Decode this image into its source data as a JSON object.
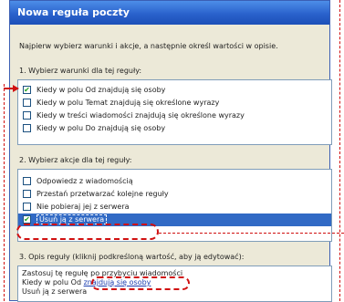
{
  "window": {
    "title": "Nowa reguła poczty"
  },
  "intro": "Najpierw wybierz warunki i akcje, a następnie określ wartości w opisie.",
  "conditions": {
    "label": "1. Wybierz warunki dla tej reguły:",
    "items": [
      {
        "label": "Kiedy w polu Od znajdują się osoby",
        "checked": true
      },
      {
        "label": "Kiedy w polu Temat znajdują się określone wyrazy",
        "checked": false
      },
      {
        "label": "Kiedy w treści wiadomości znajdują się określone wyrazy",
        "checked": false
      },
      {
        "label": "Kiedy w polu Do znajdują się osoby",
        "checked": false
      }
    ]
  },
  "actions": {
    "label": "2. Wybierz akcje dla tej reguły:",
    "items": [
      {
        "label": "Odpowiedz z wiadomością",
        "checked": false
      },
      {
        "label": "Przestań przetwarzać kolejne reguły",
        "checked": false
      },
      {
        "label": "Nie pobieraj jej z serwera",
        "checked": false
      },
      {
        "label": "Usuń ją z serwera",
        "checked": true,
        "selected": true
      }
    ]
  },
  "description": {
    "label": "3. Opis reguły (kliknij podkreśloną wartość, aby ją edytować):",
    "line1": "Zastosuj tę regułę po przybyciu wiadomości",
    "line2_prefix": "Kiedy w polu Od",
    "line2_link": "znajdują się osoby",
    "line3": "Usuń ją z serwera"
  }
}
